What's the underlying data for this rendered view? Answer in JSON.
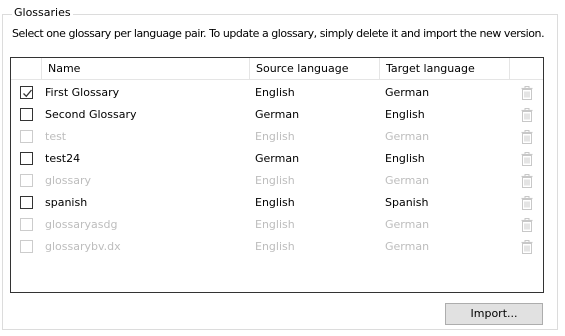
{
  "groupbox": {
    "title": "Glossaries",
    "description": "Select one glossary per language pair. To update a glossary, simply delete it and import the new version."
  },
  "table": {
    "columns": [
      "Name",
      "Source language",
      "Target language"
    ],
    "rows": [
      {
        "name": "First Glossary",
        "source": "English",
        "target": "German",
        "checked": true,
        "enabled": true
      },
      {
        "name": "Second Glossary",
        "source": "German",
        "target": "English",
        "checked": false,
        "enabled": true
      },
      {
        "name": "test",
        "source": "English",
        "target": "German",
        "checked": false,
        "enabled": false
      },
      {
        "name": "test24",
        "source": "German",
        "target": "English",
        "checked": false,
        "enabled": true
      },
      {
        "name": "glossary",
        "source": "English",
        "target": "German",
        "checked": false,
        "enabled": false
      },
      {
        "name": "spanish",
        "source": "English",
        "target": "Spanish",
        "checked": false,
        "enabled": true
      },
      {
        "name": "glossaryasdg",
        "source": "English",
        "target": "German",
        "checked": false,
        "enabled": false
      },
      {
        "name": "glossarybv.dx",
        "source": "English",
        "target": "German",
        "checked": false,
        "enabled": false
      }
    ],
    "delete_icon": "trash-icon"
  },
  "buttons": {
    "import_label": "Import..."
  },
  "colors": {
    "border": "#333333",
    "disabled_text": "#bdbdbd",
    "icon": "#c8c8c8",
    "button_bg": "#e1e1e1"
  }
}
